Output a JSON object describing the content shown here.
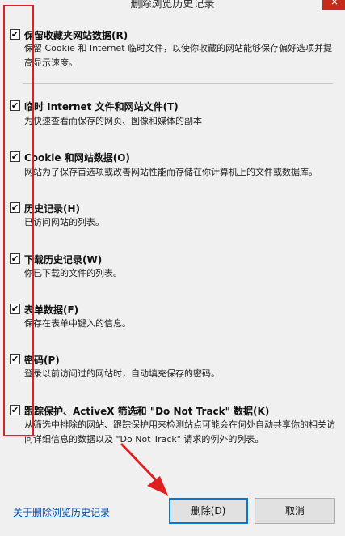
{
  "window": {
    "title": "删除浏览历史记录",
    "close_glyph": "×"
  },
  "options": [
    {
      "label": "保留收藏夹网站数据(R)",
      "checked": true,
      "desc": "保留 Cookie 和 Internet 临时文件，以使你收藏的网站能够保存偏好选项并提高显示速度。"
    },
    {
      "label": "临时 Internet 文件和网站文件(T)",
      "checked": true,
      "desc": "为快速查看而保存的网页、图像和媒体的副本"
    },
    {
      "label": "Cookie 和网站数据(O)",
      "checked": true,
      "desc": "网站为了保存首选项或改善网站性能而存储在你计算机上的文件或数据库。"
    },
    {
      "label": "历史记录(H)",
      "checked": true,
      "desc": "已访问网站的列表。"
    },
    {
      "label": "下载历史记录(W)",
      "checked": true,
      "desc": "你已下载的文件的列表。"
    },
    {
      "label": "表单数据(F)",
      "checked": true,
      "desc": "保存在表单中键入的信息。"
    },
    {
      "label": "密码(P)",
      "checked": true,
      "desc": "登录以前访问过的网站时，自动填充保存的密码。"
    },
    {
      "label": "跟踪保护、ActiveX 筛选和 \"Do Not Track\" 数据(K)",
      "checked": true,
      "desc": "从筛选中排除的网站、跟踪保护用来检测站点可能会在何处自动共享你的相关访问详细信息的数据以及 \"Do Not Track\" 请求的例外的列表。"
    }
  ],
  "footer": {
    "about_link": "关于删除浏览历史记录",
    "delete_button": "删除(D)",
    "cancel_button": "取消"
  },
  "checkmark": "✔",
  "annotation_color": "#e02020"
}
